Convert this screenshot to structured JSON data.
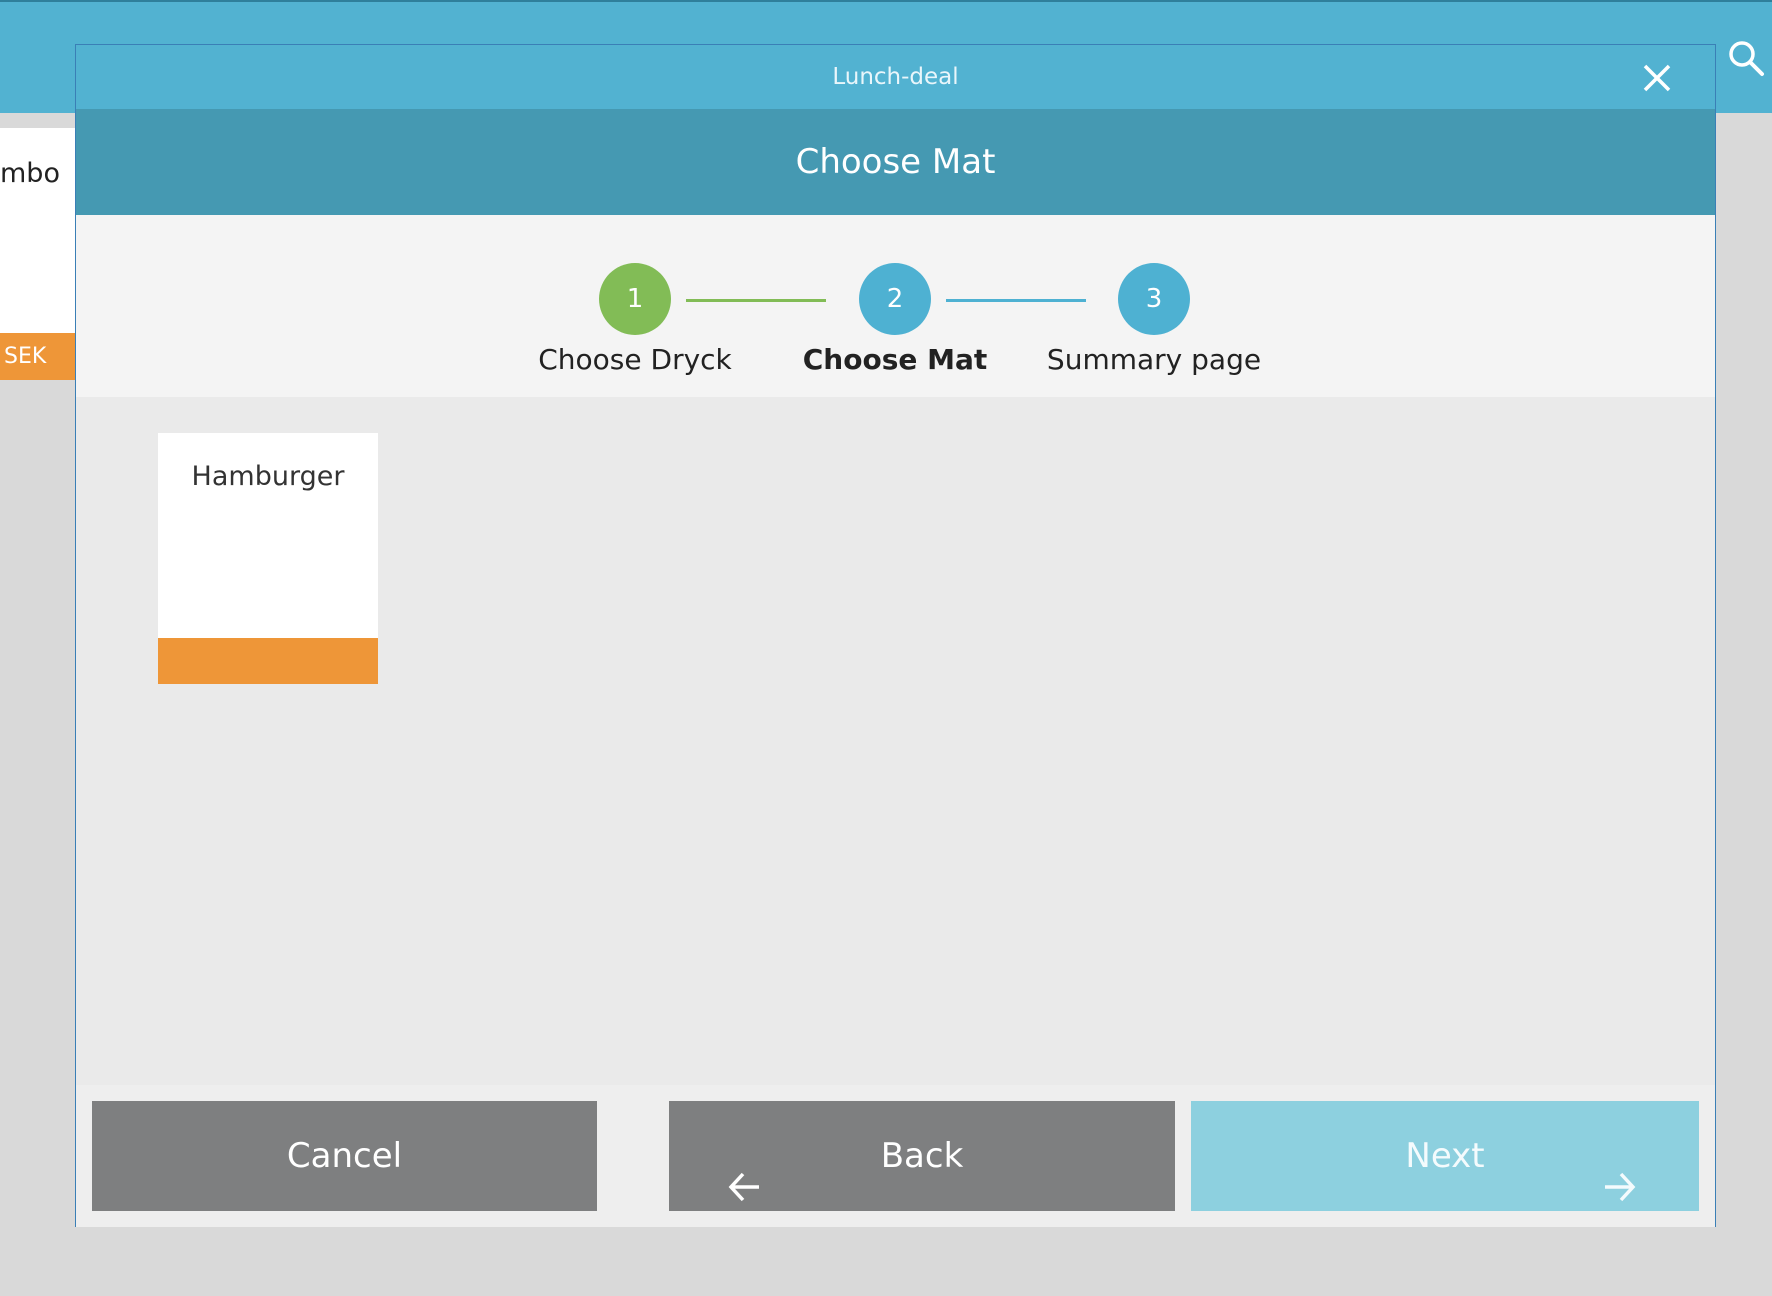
{
  "background": {
    "card_name_fragment": "mbo",
    "card_price_fragment": "SEK"
  },
  "modal": {
    "title": "Lunch-deal",
    "step_header": "Choose Mat",
    "steps": [
      {
        "number": "1",
        "label": "Choose Dryck",
        "state": "completed",
        "color": "#82bc56"
      },
      {
        "number": "2",
        "label": "Choose Mat",
        "state": "active",
        "color": "#4eb1d2"
      },
      {
        "number": "3",
        "label": "Summary page",
        "state": "upcoming",
        "color": "#4eb1d2"
      }
    ],
    "products": [
      {
        "name": "Hamburger",
        "accent": "#ee9638"
      }
    ],
    "footer": {
      "cancel_label": "Cancel",
      "back_label": "Back",
      "next_label": "Next"
    }
  },
  "colors": {
    "primary": "#52b2d1",
    "header": "#4599b2",
    "completed": "#82bc56",
    "accent": "#ee9638",
    "button_gray": "#7e7f80",
    "button_next_disabled": "#8dd0df"
  },
  "icons": {
    "search": "search-icon",
    "close": "close-icon",
    "back": "arrow-left-icon",
    "next": "arrow-right-icon"
  }
}
